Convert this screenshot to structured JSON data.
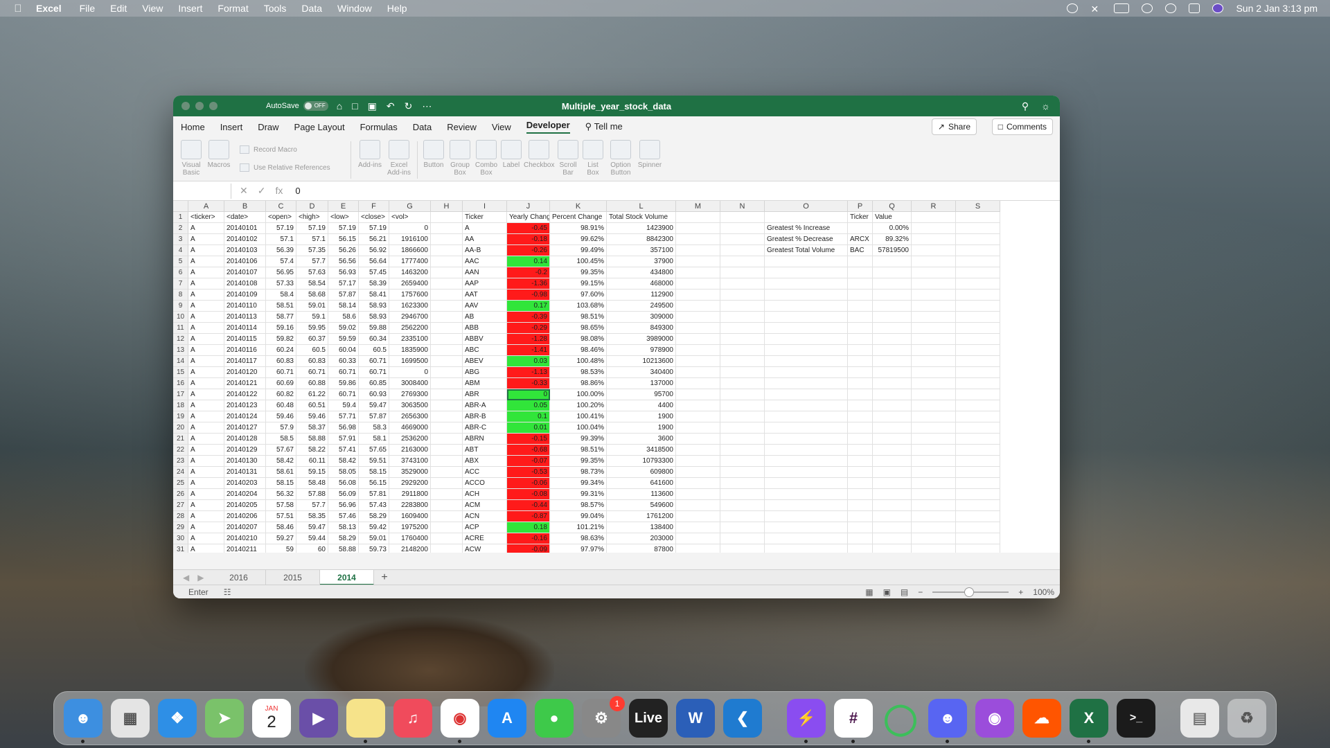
{
  "menubar": {
    "app": "Excel",
    "items": [
      "File",
      "Edit",
      "View",
      "Insert",
      "Format",
      "Tools",
      "Data",
      "Window",
      "Help"
    ],
    "datetime": "Sun 2 Jan  3:13 pm"
  },
  "window": {
    "autosave_label": "AutoSave",
    "autosave_state": "OFF",
    "title": "Multiple_year_stock_data"
  },
  "ribbon": {
    "tabs": [
      "Home",
      "Insert",
      "Draw",
      "Page Layout",
      "Formulas",
      "Data",
      "Review",
      "View",
      "Developer",
      "Tell me"
    ],
    "active_tab": "Developer",
    "share": "Share",
    "comments": "Comments",
    "buttons": {
      "visual_basic": "Visual Basic",
      "macros": "Macros",
      "record_macro": "Record Macro",
      "relative_refs": "Use Relative References",
      "add_ins": "Add-ins",
      "excel_add_ins": "Excel Add-ins",
      "button": "Button",
      "group_box": "Group Box",
      "combo_box": "Combo Box",
      "label": "Label",
      "checkbox": "Checkbox",
      "scroll_bar": "Scroll Bar",
      "list_box": "List Box",
      "option_button": "Option Button",
      "spinner": "Spinner"
    }
  },
  "formula_bar": {
    "name_box": "",
    "fx": "fx",
    "value": "0"
  },
  "columns": [
    "A",
    "B",
    "C",
    "D",
    "E",
    "F",
    "G",
    "H",
    "I",
    "J",
    "K",
    "L",
    "M",
    "N",
    "O",
    "P",
    "Q",
    "R",
    "S"
  ],
  "header_row": [
    "<ticker>",
    "<date>",
    "<open>",
    "<high>",
    "<low>",
    "<close>",
    "<vol>",
    "",
    "Ticker",
    "Yearly Change",
    "Percent Change",
    "Total Stock Volume"
  ],
  "rows": [
    [
      "A",
      "20140101",
      "57.19",
      "57.19",
      "57.19",
      "57.19",
      "0",
      "",
      "A",
      "-0.45",
      "98.91%",
      "1423900"
    ],
    [
      "A",
      "20140102",
      "57.1",
      "57.1",
      "56.15",
      "56.21",
      "1916100",
      "",
      "AA",
      "-0.18",
      "99.62%",
      "8842300"
    ],
    [
      "A",
      "20140103",
      "56.39",
      "57.35",
      "56.26",
      "56.92",
      "1866600",
      "",
      "AA-B",
      "-0.26",
      "99.49%",
      "357100"
    ],
    [
      "A",
      "20140106",
      "57.4",
      "57.7",
      "56.56",
      "56.64",
      "1777400",
      "",
      "AAC",
      "0.14",
      "100.45%",
      "37900"
    ],
    [
      "A",
      "20140107",
      "56.95",
      "57.63",
      "56.93",
      "57.45",
      "1463200",
      "",
      "AAN",
      "-0.2",
      "99.35%",
      "434800"
    ],
    [
      "A",
      "20140108",
      "57.33",
      "58.54",
      "57.17",
      "58.39",
      "2659400",
      "",
      "AAP",
      "-1.36",
      "99.15%",
      "468000"
    ],
    [
      "A",
      "20140109",
      "58.4",
      "58.68",
      "57.87",
      "58.41",
      "1757600",
      "",
      "AAT",
      "-0.98",
      "97.60%",
      "112900"
    ],
    [
      "A",
      "20140110",
      "58.51",
      "59.01",
      "58.14",
      "58.93",
      "1623300",
      "",
      "AAV",
      "0.17",
      "103.68%",
      "249500"
    ],
    [
      "A",
      "20140113",
      "58.77",
      "59.1",
      "58.6",
      "58.93",
      "2946700",
      "",
      "AB",
      "-0.39",
      "98.51%",
      "309000"
    ],
    [
      "A",
      "20140114",
      "59.16",
      "59.95",
      "59.02",
      "59.88",
      "2562200",
      "",
      "ABB",
      "-0.29",
      "98.65%",
      "849300"
    ],
    [
      "A",
      "20140115",
      "59.82",
      "60.37",
      "59.59",
      "60.34",
      "2335100",
      "",
      "ABBV",
      "-1.28",
      "98.08%",
      "3989000"
    ],
    [
      "A",
      "20140116",
      "60.24",
      "60.5",
      "60.04",
      "60.5",
      "1835900",
      "",
      "ABC",
      "-1.41",
      "98.46%",
      "978900"
    ],
    [
      "A",
      "20140117",
      "60.83",
      "60.83",
      "60.33",
      "60.71",
      "1699500",
      "",
      "ABEV",
      "0.03",
      "100.48%",
      "10213600"
    ],
    [
      "A",
      "20140120",
      "60.71",
      "60.71",
      "60.71",
      "60.71",
      "0",
      "",
      "ABG",
      "-1.13",
      "98.53%",
      "340400"
    ],
    [
      "A",
      "20140121",
      "60.69",
      "60.88",
      "59.86",
      "60.85",
      "3008400",
      "",
      "ABM",
      "-0.33",
      "98.86%",
      "137000"
    ],
    [
      "A",
      "20140122",
      "60.82",
      "61.22",
      "60.71",
      "60.93",
      "2769300",
      "",
      "ABR",
      "0",
      "100.00%",
      "95700"
    ],
    [
      "A",
      "20140123",
      "60.48",
      "60.51",
      "59.4",
      "59.47",
      "3063500",
      "",
      "ABR-A",
      "0.05",
      "100.20%",
      "4400"
    ],
    [
      "A",
      "20140124",
      "59.46",
      "59.46",
      "57.71",
      "57.87",
      "2656300",
      "",
      "ABR-B",
      "0.1",
      "100.41%",
      "1900"
    ],
    [
      "A",
      "20140127",
      "57.9",
      "58.37",
      "56.98",
      "58.3",
      "4669000",
      "",
      "ABR-C",
      "0.01",
      "100.04%",
      "1900"
    ],
    [
      "A",
      "20140128",
      "58.5",
      "58.88",
      "57.91",
      "58.1",
      "2536200",
      "",
      "ABRN",
      "-0.15",
      "99.39%",
      "3600"
    ],
    [
      "A",
      "20140129",
      "57.67",
      "58.22",
      "57.41",
      "57.65",
      "2163000",
      "",
      "ABT",
      "-0.68",
      "98.51%",
      "3418500"
    ],
    [
      "A",
      "20140130",
      "58.42",
      "60.11",
      "58.42",
      "59.51",
      "3743100",
      "",
      "ABX",
      "-0.07",
      "99.35%",
      "10793300"
    ],
    [
      "A",
      "20140131",
      "58.61",
      "59.15",
      "58.05",
      "58.15",
      "3529000",
      "",
      "ACC",
      "-0.53",
      "98.73%",
      "609800"
    ],
    [
      "A",
      "20140203",
      "58.15",
      "58.48",
      "56.08",
      "56.15",
      "2929200",
      "",
      "ACCO",
      "-0.06",
      "99.34%",
      "641600"
    ],
    [
      "A",
      "20140204",
      "56.32",
      "57.88",
      "56.09",
      "57.81",
      "2911800",
      "",
      "ACH",
      "-0.08",
      "99.31%",
      "113600"
    ],
    [
      "A",
      "20140205",
      "57.58",
      "57.7",
      "56.96",
      "57.43",
      "2283800",
      "",
      "ACM",
      "-0.44",
      "98.57%",
      "549600"
    ],
    [
      "A",
      "20140206",
      "57.51",
      "58.35",
      "57.46",
      "58.29",
      "1609400",
      "",
      "ACN",
      "-0.87",
      "99.04%",
      "1761200"
    ],
    [
      "A",
      "20140207",
      "58.46",
      "59.47",
      "58.13",
      "59.42",
      "1975200",
      "",
      "ACP",
      "0.18",
      "101.21%",
      "138400"
    ],
    [
      "A",
      "20140210",
      "59.27",
      "59.44",
      "58.29",
      "59.01",
      "1760400",
      "",
      "ACRE",
      "-0.16",
      "98.63%",
      "203000"
    ],
    [
      "A",
      "20140211",
      "59",
      "60",
      "58.88",
      "59.73",
      "2148200",
      "",
      "ACW",
      "-0.09",
      "97.97%",
      "87800"
    ]
  ],
  "summary": {
    "headers": [
      "",
      "Ticker",
      "Value"
    ],
    "rows": [
      [
        "Greatest % Increase",
        "",
        "0.00%"
      ],
      [
        "Greatest % Decrease",
        "ARCX",
        "89.32%"
      ],
      [
        "Greatest Total Volume",
        "BAC",
        "57819500"
      ]
    ]
  },
  "sheets": [
    "2016",
    "2015",
    "2014"
  ],
  "active_sheet": "2014",
  "status": {
    "mode": "Enter",
    "zoom": "100%"
  },
  "dock": {
    "calendar_month": "JAN",
    "calendar_day": "2",
    "settings_badge": "1",
    "live_label": "Live",
    "apps": [
      "finder-icon",
      "launchpad-icon",
      "safari-icon",
      "maps-icon",
      "calendar-icon",
      "vs-icon",
      "notes-icon",
      "music-icon",
      "chrome-icon",
      "appstore-icon",
      "messages-icon",
      "settings-icon",
      "ableton-live-icon",
      "word-icon",
      "vscode-icon",
      "messenger-icon",
      "slack-icon",
      "circle-app-icon",
      "discord-icon",
      "podcasts-icon",
      "soundcloud-icon",
      "excel-icon",
      "terminal-icon",
      "documents-icon",
      "trash-icon"
    ]
  },
  "colors": {
    "excel_green": "#1f7144",
    "negative": "#ff1a1a",
    "positive": "#31e53a"
  }
}
